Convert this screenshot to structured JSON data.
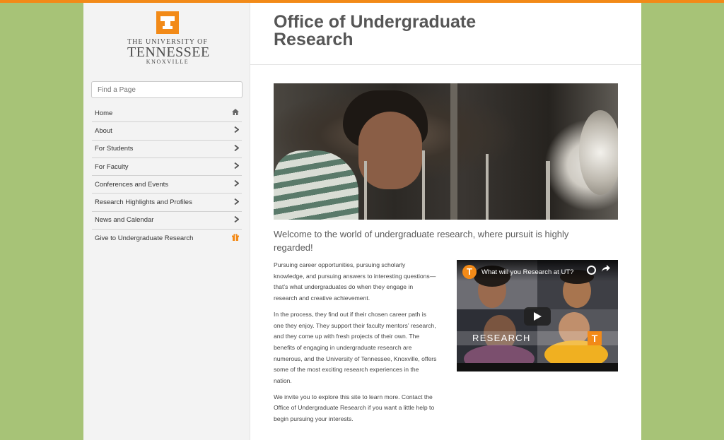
{
  "colors": {
    "accent_orange": "#f28a18",
    "background_green": "#a7c377",
    "sidebar_bg": "#f3f3f3",
    "title_gray": "#565656"
  },
  "logo": {
    "letter": "T",
    "line1": "THE UNIVERSITY OF",
    "line2": "TENNESSEE",
    "line3": "KNOXVILLE"
  },
  "search": {
    "placeholder": "Find a Page"
  },
  "sidebar": {
    "items": [
      {
        "label": "Home",
        "icon": "home-icon"
      },
      {
        "label": "About",
        "icon": "chevron-right-icon"
      },
      {
        "label": "For Students",
        "icon": "chevron-right-icon"
      },
      {
        "label": "For Faculty",
        "icon": "chevron-right-icon"
      },
      {
        "label": "Conferences and Events",
        "icon": "chevron-right-icon"
      },
      {
        "label": "Research Highlights and Profiles",
        "icon": "chevron-right-icon"
      },
      {
        "label": "News and Calendar",
        "icon": "chevron-right-icon"
      },
      {
        "label": "Give to Undergraduate Research",
        "icon": "gift-icon"
      }
    ]
  },
  "header": {
    "title": "Office of Undergraduate Research"
  },
  "main": {
    "tagline": "Welcome to the world of undergraduate research, where pursuit is highly regarded!",
    "paragraphs": [
      "Pursuing career opportunities, pursuing scholarly knowledge, and pursuing answers to interesting questions—that’s what undergraduates do when they engage in research and creative achievement.",
      "In the process, they find out if their chosen career path is one they enjoy. They support their faculty mentors’ research, and they come up with fresh projects of their own. The benefits of engaging in undergraduate research are numerous, and the University of Tennessee, Knoxville, offers some of the most exciting research experiences in the nation.",
      "We invite you to explore this site to learn more. Contact the Office of Undergraduate Research if you want a little help to begin pursuing your interests."
    ]
  },
  "video": {
    "channel_letter": "T",
    "title": "What will you Research at UT?",
    "overlay_text": "RESEARCH",
    "corner_letter": "T"
  }
}
